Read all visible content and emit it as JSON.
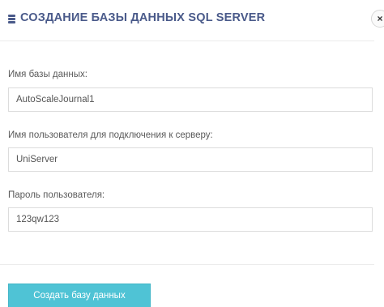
{
  "dialog": {
    "title": "СОЗДАНИЕ БАЗЫ ДАННЫХ SQL SERVER",
    "title_icon": "database-icon",
    "close_label": "×"
  },
  "form": {
    "db_name_label": "Имя базы данных:",
    "db_name_value": "AutoScaleJournal1",
    "user_label": "Имя пользователя для подключения к серверу:",
    "user_value": "UniServer",
    "password_label": "Пароль пользователя:",
    "password_value": "123qw123"
  },
  "actions": {
    "create_label": "Создать базу данных"
  },
  "colors": {
    "title": "#4a5a8a",
    "button": "#4fc3d5"
  }
}
